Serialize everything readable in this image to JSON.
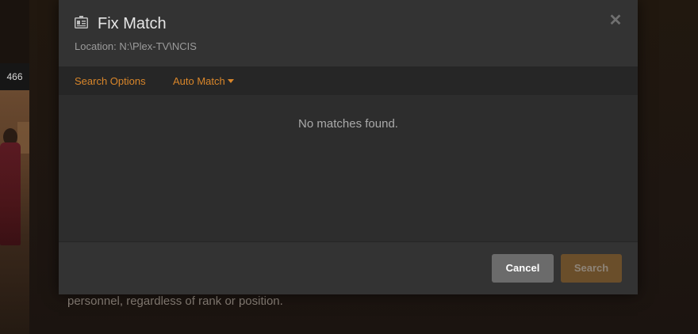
{
  "background": {
    "item_count": "466",
    "summary_fragment": "personnel, regardless of rank or position."
  },
  "modal": {
    "icon": "id-card-icon",
    "title": "Fix Match",
    "location": "Location: N:\\Plex-TV\\NCIS",
    "close_icon": "close-icon",
    "options": {
      "search_options_label": "Search Options",
      "auto_match_label": "Auto Match"
    },
    "results": {
      "empty_message": "No matches found."
    },
    "footer": {
      "cancel_label": "Cancel",
      "search_label": "Search"
    }
  },
  "colors": {
    "accent": "#d9862a",
    "modal_bg": "#2d2d2d",
    "header_bg": "#333333",
    "options_bar_bg": "#262626",
    "cancel_bg": "#6b6b6b",
    "search_bg_disabled": "#6a4e2a"
  }
}
